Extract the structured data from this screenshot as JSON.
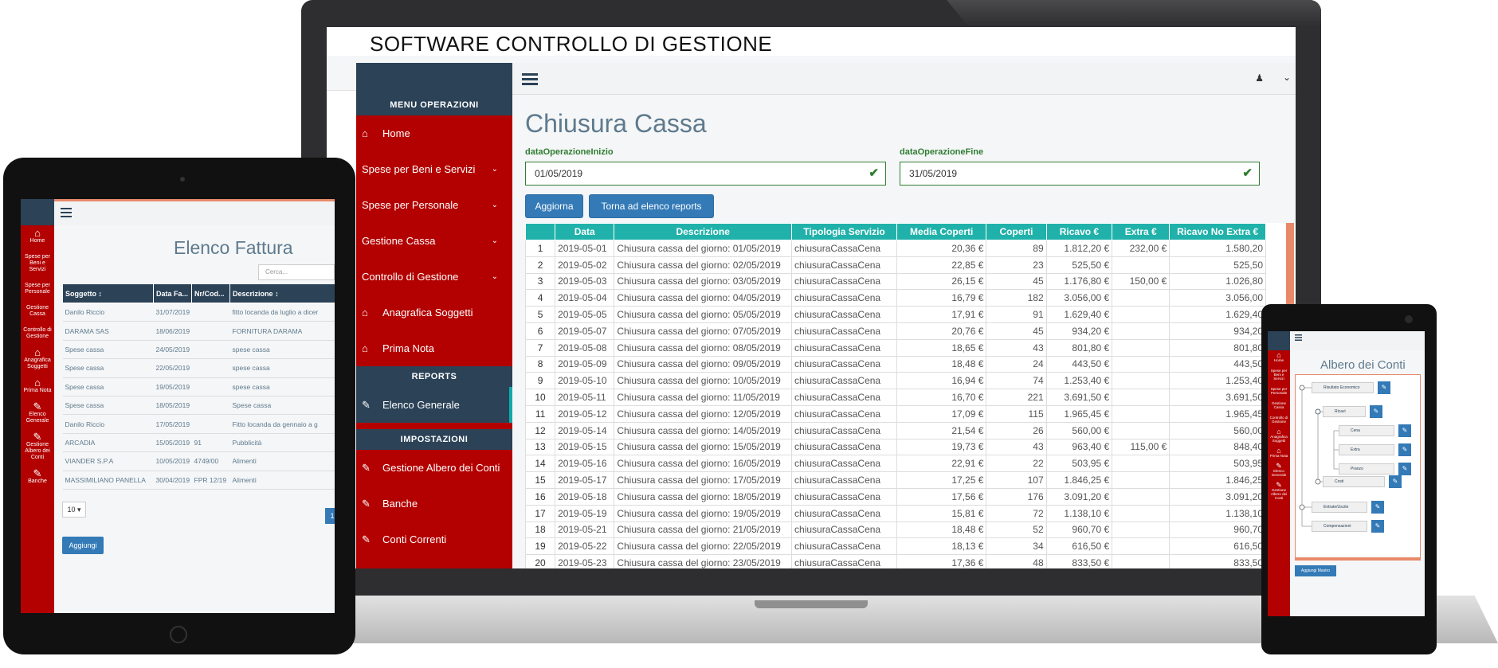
{
  "laptop": {
    "app_title": "SOFTWARE CONTROLLO DI GESTIONE",
    "sidebar": {
      "section_menu": "MENU OPERAZIONI",
      "section_reports": "REPORTS",
      "section_settings": "IMPOSTAZIONI",
      "items": [
        {
          "label": "Home",
          "icon": "home-icon"
        },
        {
          "label": "Spese per Beni e Servizi",
          "icon": ""
        },
        {
          "label": "Spese per Personale",
          "icon": ""
        },
        {
          "label": "Gestione Cassa",
          "icon": ""
        },
        {
          "label": "Controllo di Gestione",
          "icon": ""
        },
        {
          "label": "Anagrafica Soggetti",
          "icon": "home-icon"
        },
        {
          "label": "Prima Nota",
          "icon": "home-icon"
        },
        {
          "label": "Elenco Generale",
          "icon": "edit-icon"
        },
        {
          "label": "Gestione Albero dei Conti",
          "icon": "edit-icon"
        },
        {
          "label": "Banche",
          "icon": "edit-icon"
        },
        {
          "label": "Conti Correnti",
          "icon": "edit-icon"
        }
      ]
    },
    "main": {
      "title": "Chiusura Cassa",
      "start_label": "dataOperazioneInizio",
      "start_value": "01/05/2019",
      "end_label": "dataOperazioneFine",
      "end_value": "31/05/2019",
      "btn_update": "Aggiorna",
      "btn_back": "Torna ad elenco reports",
      "table": {
        "headers": [
          "",
          "Data",
          "Descrizione",
          "Tipologia Servizio",
          "Media Coperti",
          "Coperti",
          "Ricavo €",
          "Extra €",
          "Ricavo No Extra €"
        ],
        "rows": [
          [
            "1",
            "2019-05-01",
            "Chiusura cassa del giorno: 01/05/2019",
            "chiusuraCassaCena",
            "20,36 €",
            "89",
            "1.812,20 €",
            "232,00 €",
            "1.580,20"
          ],
          [
            "2",
            "2019-05-02",
            "Chiusura cassa del giorno: 02/05/2019",
            "chiusuraCassaCena",
            "22,85 €",
            "23",
            "525,50 €",
            "",
            "525,50"
          ],
          [
            "3",
            "2019-05-03",
            "Chiusura cassa del giorno: 03/05/2019",
            "chiusuraCassaCena",
            "26,15 €",
            "45",
            "1.176,80 €",
            "150,00 €",
            "1.026,80"
          ],
          [
            "4",
            "2019-05-04",
            "Chiusura cassa del giorno: 04/05/2019",
            "chiusuraCassaCena",
            "16,79 €",
            "182",
            "3.056,00 €",
            "",
            "3.056,00"
          ],
          [
            "5",
            "2019-05-05",
            "Chiusura cassa del giorno: 05/05/2019",
            "chiusuraCassaCena",
            "17,91 €",
            "91",
            "1.629,40 €",
            "",
            "1.629,40"
          ],
          [
            "6",
            "2019-05-07",
            "Chiusura cassa del giorno: 07/05/2019",
            "chiusuraCassaCena",
            "20,76 €",
            "45",
            "934,20 €",
            "",
            "934,20"
          ],
          [
            "7",
            "2019-05-08",
            "Chiusura cassa del giorno: 08/05/2019",
            "chiusuraCassaCena",
            "18,65 €",
            "43",
            "801,80 €",
            "",
            "801,80"
          ],
          [
            "8",
            "2019-05-09",
            "Chiusura cassa del giorno: 09/05/2019",
            "chiusuraCassaCena",
            "18,48 €",
            "24",
            "443,50 €",
            "",
            "443,50"
          ],
          [
            "9",
            "2019-05-10",
            "Chiusura cassa del giorno: 10/05/2019",
            "chiusuraCassaCena",
            "16,94 €",
            "74",
            "1.253,40 €",
            "",
            "1.253,40"
          ],
          [
            "10",
            "2019-05-11",
            "Chiusura cassa del giorno: 11/05/2019",
            "chiusuraCassaCena",
            "16,70 €",
            "221",
            "3.691,50 €",
            "",
            "3.691,50"
          ],
          [
            "11",
            "2019-05-12",
            "Chiusura cassa del giorno: 12/05/2019",
            "chiusuraCassaCena",
            "17,09 €",
            "115",
            "1.965,45 €",
            "",
            "1.965,45"
          ],
          [
            "12",
            "2019-05-14",
            "Chiusura cassa del giorno: 14/05/2019",
            "chiusuraCassaCena",
            "21,54 €",
            "26",
            "560,00 €",
            "",
            "560,00"
          ],
          [
            "13",
            "2019-05-15",
            "Chiusura cassa del giorno: 15/05/2019",
            "chiusuraCassaCena",
            "19,73 €",
            "43",
            "963,40 €",
            "115,00 €",
            "848,40"
          ],
          [
            "14",
            "2019-05-16",
            "Chiusura cassa del giorno: 16/05/2019",
            "chiusuraCassaCena",
            "22,91 €",
            "22",
            "503,95 €",
            "",
            "503,95"
          ],
          [
            "15",
            "2019-05-17",
            "Chiusura cassa del giorno: 17/05/2019",
            "chiusuraCassaCena",
            "17,25 €",
            "107",
            "1.846,25 €",
            "",
            "1.846,25"
          ],
          [
            "16",
            "2019-05-18",
            "Chiusura cassa del giorno: 18/05/2019",
            "chiusuraCassaCena",
            "17,56 €",
            "176",
            "3.091,20 €",
            "",
            "3.091,20"
          ],
          [
            "17",
            "2019-05-19",
            "Chiusura cassa del giorno: 19/05/2019",
            "chiusuraCassaCena",
            "15,81 €",
            "72",
            "1.138,10 €",
            "",
            "1.138,10"
          ],
          [
            "18",
            "2019-05-21",
            "Chiusura cassa del giorno: 21/05/2019",
            "chiusuraCassaCena",
            "18,48 €",
            "52",
            "960,70 €",
            "",
            "960,70"
          ],
          [
            "19",
            "2019-05-22",
            "Chiusura cassa del giorno: 22/05/2019",
            "chiusuraCassaCena",
            "18,13 €",
            "34",
            "616,50 €",
            "",
            "616,50"
          ],
          [
            "20",
            "2019-05-23",
            "Chiusura cassa del giorno: 23/05/2019",
            "chiusuraCassaCena",
            "17,36 €",
            "48",
            "833,50 €",
            "",
            "833,50"
          ]
        ]
      }
    }
  },
  "tablet": {
    "title": "Elenco Fattura",
    "search_placeholder": "Cerca...",
    "sidebar": [
      "Home",
      "Spese per Beni e Servizi",
      "Spese per Personale",
      "Gestione Cassa",
      "Controllo di Gestione",
      "Anagrafica Soggetti",
      "Prima Nota",
      "Elenco Generale",
      "Gestione Albero dei Conti",
      "Banche"
    ],
    "headers": [
      "Soggetto ↕",
      "Data Fa...",
      "Nr/Cod...",
      "Descrizione ↕"
    ],
    "rows": [
      [
        "Danilo Riccio",
        "31/07/2019",
        "",
        "fitto locanda da luglio a dicer"
      ],
      [
        "DARAMA SAS",
        "18/06/2019",
        "",
        "FORNITURA DARAMA"
      ],
      [
        "Spese cassa",
        "24/05/2019",
        "",
        "spese cassa"
      ],
      [
        "Spese cassa",
        "22/05/2019",
        "",
        "spese cassa"
      ],
      [
        "Spese cassa",
        "19/05/2019",
        "",
        "spese cassa"
      ],
      [
        "Spese cassa",
        "18/05/2019",
        "",
        "Spese cassa"
      ],
      [
        "Danilo Riccio",
        "17/05/2019",
        "",
        "Fitto locanda da gennaio a g"
      ],
      [
        "ARCADIA",
        "15/05/2019",
        "91",
        "Pubblicità"
      ],
      [
        "VIANDER S.P.A",
        "10/05/2019",
        "4749/00",
        "Alimenti"
      ],
      [
        "MASSIMILIANO PANELLA",
        "30/04/2019",
        "FPR 12/19",
        "Alimenti"
      ]
    ],
    "page_size": "10 ▾",
    "page_current": "1",
    "btn_add": "Aggiungi"
  },
  "phone": {
    "title": "Albero dei Conti",
    "sidebar": [
      "Home",
      "Spese per Beni e Servizi",
      "Spese per Personale",
      "Gestione Cassa",
      "Controllo di Gestione",
      "Anagrafica Soggetti",
      "Prima Nota",
      "Elenco Generale",
      "Gestione Albero dei Conti"
    ],
    "nodes": [
      "Risultato Economico",
      "Ricavi",
      "Cena",
      "Extra",
      "Pranzo",
      "Costi",
      "Entrate/Uscite",
      "Compensazioni"
    ],
    "btn_add": "Aggiungi Mastro"
  }
}
